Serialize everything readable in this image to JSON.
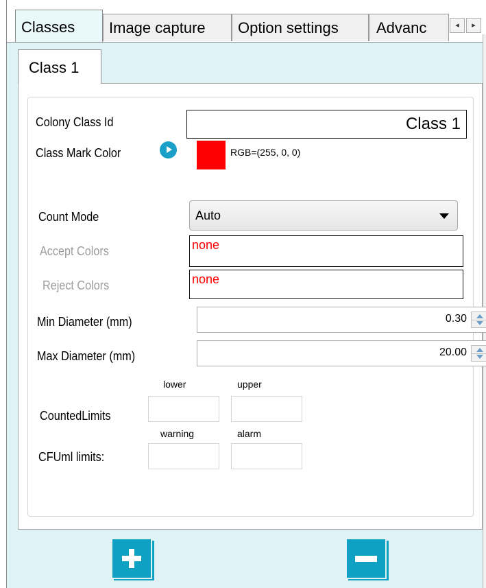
{
  "tabs": [
    {
      "label": "Classes",
      "active": true
    },
    {
      "label": "Image capture"
    },
    {
      "label": "Option settings"
    },
    {
      "label": "Advanc"
    }
  ],
  "tab_scroll": {
    "left_icon": "◂",
    "right_icon": "▸"
  },
  "class_tab": {
    "label": "Class 1"
  },
  "form": {
    "colony_class_id": {
      "label": "Colony Class Id",
      "value": "Class 1"
    },
    "class_mark_color": {
      "label": "Class Mark Color",
      "swatch_color": "#ff0000",
      "rgb_text": "RGB=(255, 0, 0)"
    },
    "count_mode": {
      "label": "Count Mode",
      "value": "Auto"
    },
    "accept_colors": {
      "label": "Accept Colors",
      "value": "none"
    },
    "reject_colors": {
      "label": "Reject Colors",
      "value": "none"
    },
    "min_diameter": {
      "label": "Min Diameter (mm)",
      "value": "0.30"
    },
    "max_diameter": {
      "label": "Max Diameter (mm)",
      "value": "20.00"
    },
    "counted_limits": {
      "label": "CountedLimits",
      "lower_label": "lower",
      "upper_label": "upper",
      "lower": "",
      "upper": ""
    },
    "cfuml_limits": {
      "label": "CFUml limits:",
      "warning_label": "warning",
      "alarm_label": "alarm",
      "warning": "",
      "alarm": ""
    }
  },
  "buttons": {
    "add_icon": "plus-icon",
    "remove_icon": "minus-icon"
  },
  "colors": {
    "accent": "#0fa1c4",
    "panel_bg": "#dff3f7",
    "invalid_text": "#ff0000"
  }
}
